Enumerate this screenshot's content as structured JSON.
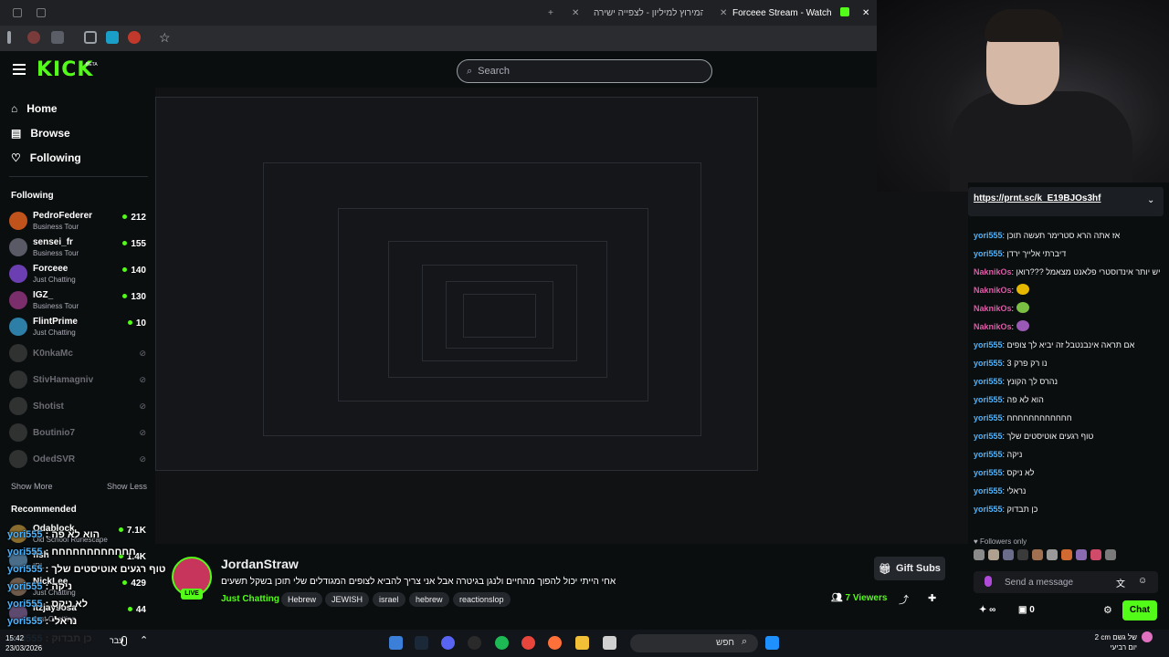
{
  "browser": {
    "tabs": [
      {
        "label": "המירוץ למיליון - לצפייה ישירה"
      },
      {
        "label": "Forceee Stream - Watch Live o"
      }
    ]
  },
  "header": {
    "logo": "KICK",
    "logo_badge": "BETA",
    "search_placeholder": "Search"
  },
  "nav": {
    "home": "Home",
    "browse": "Browse",
    "following": "Following"
  },
  "sidebar": {
    "following_title": "Following",
    "following": [
      {
        "name": "PedroFederer",
        "category": "Business Tour",
        "viewers": "212",
        "color": "#c0531b"
      },
      {
        "name": "sensei_fr",
        "category": "Business Tour",
        "viewers": "155",
        "color": "#5a5a66"
      },
      {
        "name": "Forceee",
        "category": "Just Chatting",
        "viewers": "140",
        "color": "#6b3fb2"
      },
      {
        "name": "IGZ_",
        "category": "Business Tour",
        "viewers": "130",
        "color": "#7a2e6b"
      },
      {
        "name": "FlintPrime",
        "category": "Just Chatting",
        "viewers": "10",
        "color": "#2d7fa8"
      }
    ],
    "offline": [
      "K0nkaMc",
      "StivHamagniv",
      "Shotist",
      "Boutinio7",
      "OdedSVR"
    ],
    "show_more": "Show More",
    "show_less": "Show Less",
    "recommended_title": "Recommended",
    "recommended": [
      {
        "name": "Odablock",
        "category": "Old School Runescape",
        "viewers": "7.1K"
      },
      {
        "name": "fish",
        "category": "IRL",
        "viewers": "1.4K"
      },
      {
        "name": "NickLee",
        "category": "Just Chatting",
        "viewers": "429"
      },
      {
        "name": "itzjaysosa",
        "category": "Just Chatting",
        "viewers": "44"
      }
    ]
  },
  "stream": {
    "streamer": "JordanStraw",
    "live_label": "LIVE",
    "title": "אחי הייתי יכול להפוך מהחיים ולנגן בגיטרה אבל אני צריך להביא לצופים המגודלים שלי תוכן בשקל תשעים",
    "category": "Just Chatting",
    "tags": [
      "Hebrew",
      "JEWISH",
      "israel",
      "hebrew",
      "reactionslop"
    ],
    "gift_subs": "Gift Subs",
    "viewers": "7 Viewers"
  },
  "chat": {
    "pinned_link": "https://prnt.sc/k_E19BJOs3hf",
    "messages": [
      {
        "user": "yori555",
        "text": "אז אתה הרא סטרימר תעשה תוכן",
        "color": "#4db4ff"
      },
      {
        "user": "yori555",
        "text": "דיברתי אלייך ירדן",
        "color": "#4db4ff"
      },
      {
        "user": "NaknikOs",
        "text": "למה יש יותר אינדוסטרי פלאנט מצאמל ???רואן",
        "color": "#e05aa8"
      },
      {
        "user": "NaknikOs",
        "text": "",
        "color": "#e05aa8",
        "emote": "#e6b800"
      },
      {
        "user": "NaknikOs",
        "text": "",
        "color": "#e05aa8",
        "emote": "#7bc043"
      },
      {
        "user": "NaknikOs",
        "text": "",
        "color": "#e05aa8",
        "emote": "#9b59b6"
      },
      {
        "user": "yori555",
        "text": "אם תראה אינבנטבל זה יביא לך צופים",
        "color": "#4db4ff"
      },
      {
        "user": "yori555",
        "text": "נו רק פרק 3",
        "color": "#4db4ff"
      },
      {
        "user": "yori555",
        "text": "נהרס לך הקונץ",
        "color": "#4db4ff"
      },
      {
        "user": "yori555",
        "text": "הוא לא פה",
        "color": "#4db4ff"
      },
      {
        "user": "yori555",
        "text": "חחחחחחחחחחחח",
        "color": "#4db4ff"
      },
      {
        "user": "yori555",
        "text": "טוף רגעים אוטיסטים שלך",
        "color": "#4db4ff"
      },
      {
        "user": "yori555",
        "text": "ניקה",
        "color": "#4db4ff"
      },
      {
        "user": "yori555",
        "text": "לא ניקס",
        "color": "#4db4ff"
      },
      {
        "user": "yori555",
        "text": "נראלי",
        "color": "#4db4ff"
      },
      {
        "user": "yori555",
        "text": "כן תבדוק",
        "color": "#4db4ff"
      }
    ],
    "followers_only": "Followers only",
    "send_placeholder": "Send a message",
    "points": "∞",
    "points2": "0",
    "chat_button": "Chat"
  },
  "overlay_chat": [
    {
      "user": "yori555",
      "text": "הוא לא פה"
    },
    {
      "user": "yori555",
      "text": "חחחחחחחחחחחח"
    },
    {
      "user": "yori555",
      "text": "טוף רגעים אוטיסטים שלך"
    },
    {
      "user": "yori555",
      "text": "ניקה"
    },
    {
      "user": "yori555",
      "text": "לא ניקס"
    },
    {
      "user": "yori555",
      "text": "נראלי"
    },
    {
      "user": "yori555",
      "text": "כן תבדוק"
    }
  ],
  "taskbar": {
    "lang": "עבר",
    "search": "חפש",
    "weather": "2 cm של גשם",
    "weather_sub": "יום רביעי",
    "time": "15:42",
    "date": "23/03/2026"
  }
}
